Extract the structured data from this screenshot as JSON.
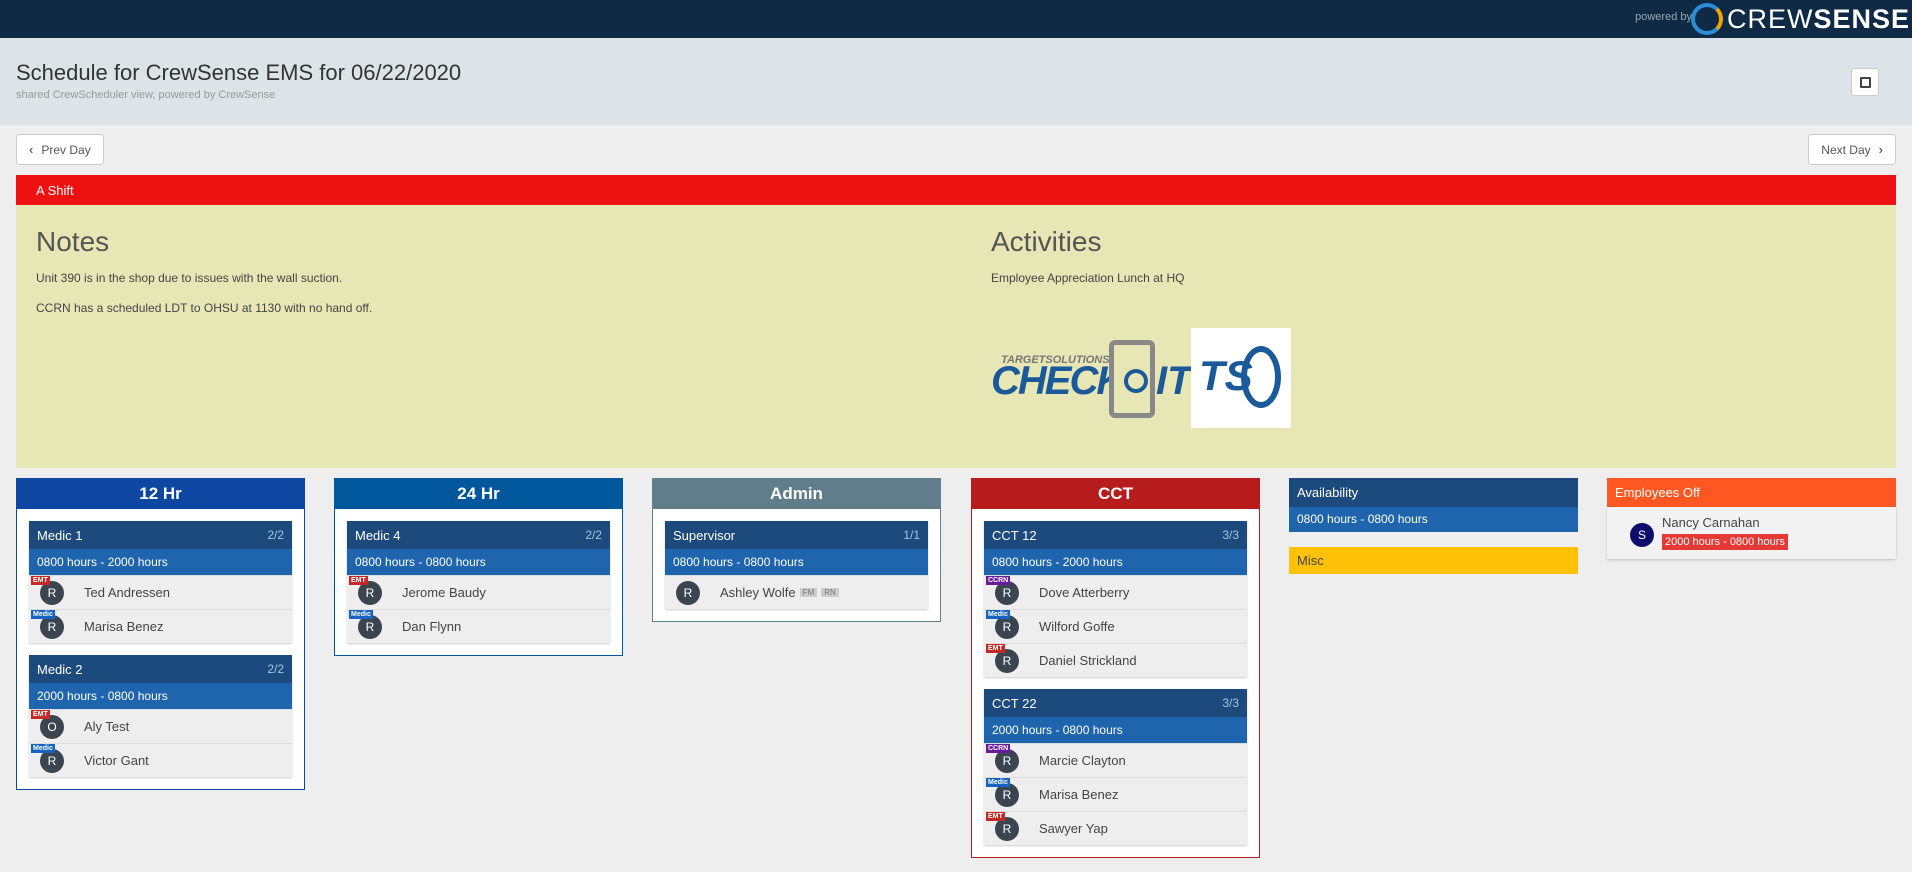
{
  "header": {
    "powered_by": "powered by",
    "brand_first": "CREW",
    "brand_second": "SENSE",
    "title": "Schedule for CrewSense EMS for 06/22/2020",
    "subtitle": "shared CrewScheduler view, powered by CrewSense",
    "fullscreen_icon": "expand-icon"
  },
  "nav": {
    "prev": "Prev Day",
    "next": "Next Day"
  },
  "shift": {
    "name": "A Shift",
    "color": "#ee1111"
  },
  "notes": {
    "heading": "Notes",
    "lines": [
      "Unit 390 is in the shop due to issues with the wall suction.",
      "CCRN has a scheduled LDT to OHSU at 1130 with no hand off."
    ]
  },
  "activities": {
    "heading": "Activities",
    "lines": [
      "Employee Appreciation Lunch at HQ"
    ],
    "logo_small": "TARGETSOLUTIONS",
    "logo_check": "CHECK",
    "logo_it": "IT",
    "logo_tso": "TS"
  },
  "columns": [
    {
      "title": "12 Hr",
      "color": "#0d47a1",
      "units": [
        {
          "name": "Medic 1",
          "count": "2/2",
          "time": "0800 hours - 2000 hours",
          "people": [
            {
              "badge": "EMT",
              "initial": "R",
              "name": "Ted Andressen"
            },
            {
              "badge": "Medic",
              "initial": "R",
              "name": "Marisa Benez"
            }
          ]
        },
        {
          "name": "Medic 2",
          "count": "2/2",
          "time": "2000 hours - 0800 hours",
          "people": [
            {
              "badge": "EMT",
              "initial": "O",
              "name": "Aly Test"
            },
            {
              "badge": "Medic",
              "initial": "R",
              "name": "Victor Gant"
            }
          ]
        }
      ]
    },
    {
      "title": "24 Hr",
      "color": "#01579b",
      "units": [
        {
          "name": "Medic 4",
          "count": "2/2",
          "time": "0800 hours - 0800 hours",
          "people": [
            {
              "badge": "EMT",
              "initial": "R",
              "name": "Jerome Baudy"
            },
            {
              "badge": "Medic",
              "initial": "R",
              "name": "Dan Flynn"
            }
          ]
        }
      ]
    },
    {
      "title": "Admin",
      "color": "#607d8b",
      "units": [
        {
          "name": "Supervisor",
          "count": "1/1",
          "time": "0800 hours - 0800 hours",
          "people": [
            {
              "badge": "",
              "initial": "R",
              "name": "Ashley Wolfe",
              "tags": [
                "FM",
                "RN"
              ]
            }
          ]
        }
      ]
    },
    {
      "title": "CCT",
      "color": "#b71c1c",
      "units": [
        {
          "name": "CCT 12",
          "count": "3/3",
          "time": "0800 hours - 2000 hours",
          "people": [
            {
              "badge": "CCRN",
              "initial": "R",
              "name": "Dove Atterberry"
            },
            {
              "badge": "Medic",
              "initial": "R",
              "name": "Wilford Goffe"
            },
            {
              "badge": "EMT",
              "initial": "R",
              "name": "Daniel Strickland"
            }
          ]
        },
        {
          "name": "CCT 22",
          "count": "3/3",
          "time": "2000 hours - 0800 hours",
          "people": [
            {
              "badge": "CCRN",
              "initial": "R",
              "name": "Marcie Clayton"
            },
            {
              "badge": "Medic",
              "initial": "R",
              "name": "Marisa Benez"
            },
            {
              "badge": "EMT",
              "initial": "R",
              "name": "Sawyer Yap"
            }
          ]
        }
      ]
    }
  ],
  "availability": {
    "title": "Availability",
    "time": "0800 hours - 0800 hours",
    "color": "#1d4a7c"
  },
  "misc": {
    "title": "Misc",
    "color": "#ffc107"
  },
  "employees_off": {
    "title": "Employees Off",
    "color": "#ff5722",
    "people": [
      {
        "initial": "S",
        "name": "Nancy Carnahan",
        "time": "2000 hours - 0800 hours"
      }
    ]
  },
  "badge_colors": {
    "EMT": "#c62828",
    "Medic": "#1565c0",
    "CCRN": "#6a1b9a"
  }
}
